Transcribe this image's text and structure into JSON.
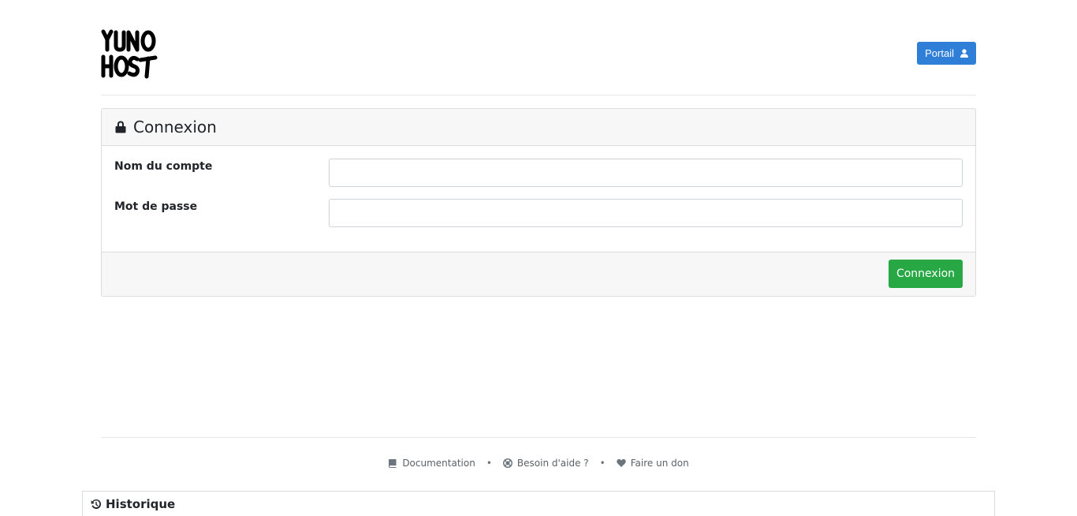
{
  "header": {
    "logo_alt": "YunoHost",
    "portal_label": "Portail"
  },
  "login_card": {
    "title": "Connexion",
    "fields": [
      {
        "label": "Nom du compte",
        "value": "",
        "placeholder": ""
      },
      {
        "label": "Mot de passe",
        "value": "",
        "placeholder": ""
      }
    ],
    "submit_label": "Connexion"
  },
  "footer": {
    "links": [
      {
        "label": "Documentation",
        "icon": "book-icon"
      },
      {
        "label": "Besoin d'aide ?",
        "icon": "lifebuoy-icon"
      },
      {
        "label": "Faire un don",
        "icon": "heart-icon"
      }
    ],
    "separator": "•"
  },
  "history": {
    "title": "Historique",
    "icon": "history-icon"
  },
  "colors": {
    "primary": "#2f7ed8",
    "success": "#28a745",
    "card_bg": "#f7f7f7",
    "border": "#dcdcdc"
  }
}
